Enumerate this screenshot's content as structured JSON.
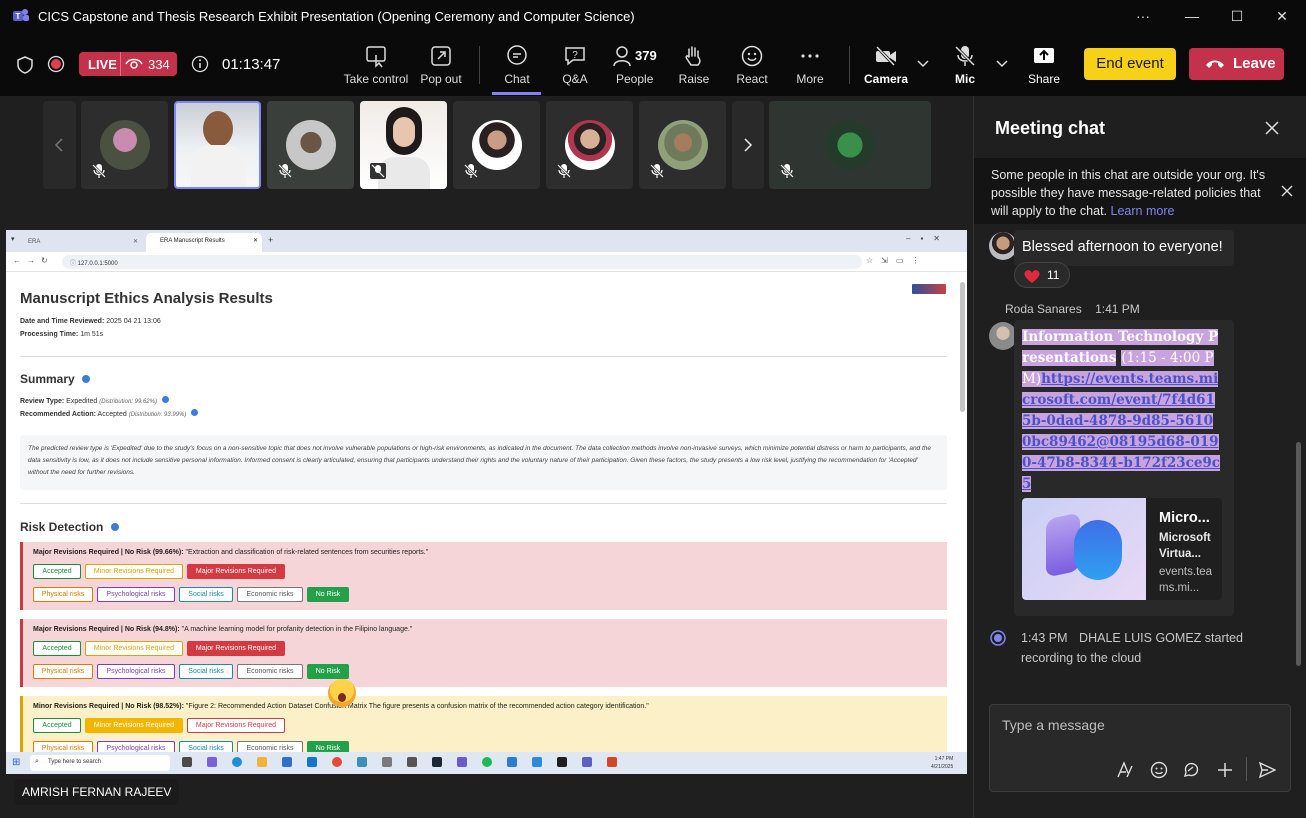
{
  "window": {
    "title": "CICS Capstone and Thesis Research Exhibit Presentation (Opening Ceremony and Computer Science)",
    "controls": [
      "···",
      "—",
      "☐",
      "✕"
    ]
  },
  "meeting": {
    "live_label": "LIVE",
    "viewers": "334",
    "timer": "01:13:47",
    "tools": {
      "take_control": "Take control",
      "pop_out": "Pop out",
      "chat": "Chat",
      "qa": "Q&A",
      "people": "People",
      "people_count": "379",
      "raise": "Raise",
      "react": "React",
      "more": "More",
      "camera": "Camera",
      "mic": "Mic",
      "share": "Share"
    },
    "end_event": "End event",
    "leave": "Leave",
    "presenter_name": "AMRISH FERNAN RAJEEV"
  },
  "browser": {
    "tabs": [
      "ERA",
      "ERA Manuscript Results"
    ],
    "url": "127.0.0.1:5000"
  },
  "report": {
    "title": "Manuscript Ethics Analysis Results",
    "date_label": "Date and Time Reviewed:",
    "date_value": "2025 04 21 13:06",
    "proc_label": "Processing Time:",
    "proc_value": "1m 51s",
    "summary_heading": "Summary",
    "review_type_label": "Review Type:",
    "review_type_value": "Expedited",
    "review_type_dist": "(Distribution: 99.62%)",
    "rec_action_label": "Recommended Action:",
    "rec_action_value": "Accepted",
    "rec_action_dist": "(Distribution: 93.99%)",
    "summary_text": "The predicted review type is 'Expedited' due to the study's focus on a non-sensitive topic that does not involve vulnerable populations or high-risk environments, as indicated in the document. The data collection methods involve non-invasive surveys, which minimize potential distress or harm to participants, and the data sensitivity is low, as it does not include sensitive personal information. Informed consent is clearly articulated, ensuring that participants understand their rights and the voluntary nature of their participation. Given these factors, the study presents a low risk level, justifying the recommendation for 'Accepted' without the need for further revisions.",
    "risk_heading": "Risk Detection",
    "action_pills": [
      "Accepted",
      "Minor Revisions Required",
      "Major Revisions Required"
    ],
    "risk_pills": [
      "Physical risks",
      "Psychological risks",
      "Social risks",
      "Economic risks",
      "No Risk"
    ],
    "risks": [
      {
        "head": "Major Revisions Required | No Risk (99.66%):",
        "text": "\"Extraction and classification of risk-related sentences from securities reports.\""
      },
      {
        "head": "Major Revisions Required | No Risk (94.8%):",
        "text": "\"A machine learning model for profanity detection in the Filipino language.\""
      },
      {
        "head": "Minor Revisions Required | No Risk (98.52%):",
        "text": "\"Figure 2: Recommended Action Dataset Confusion Matrix The figure presents a confusion matrix of the recommended action category identification.\""
      }
    ]
  },
  "taskbar": {
    "search_placeholder": "Type here to search",
    "time": "1:47 PM",
    "date": "4/21/2025"
  },
  "chat": {
    "title": "Meeting chat",
    "notice": "Some people in this chat are outside your org. It's possible they have message-related policies that will apply to the chat.",
    "learn_more": "Learn more",
    "msg1": "Blessed afternoon to everyone!",
    "reaction_count": "11",
    "sender2": "Roda Sanares",
    "time2": "1:41 PM",
    "msg2_title": "Information Technology Presentations",
    "msg2_range": "(1:15 - 4:00 PM)",
    "msg2_link": "https://events.teams.microsoft.com/event/7f4d615b-0dad-4878-9d85-56100bc89462@08195d68-0190-47b8-8344-b172f23ce9c5",
    "card_title": "Micro...",
    "card_sub": "Microsoft Virtua...",
    "card_domain": "events.teams.mi...",
    "sys_time": "1:43 PM",
    "sys_text": "DHALE LUIS GOMEZ started recording to the cloud",
    "compose_placeholder": "Type a message"
  },
  "colors": {
    "accent": "#7f85f5",
    "live_red": "#c4314b",
    "end_event_yellow": "#f7d117",
    "risk_red_bg": "#f5d5d7",
    "risk_yellow_bg": "#fbf0c7"
  }
}
